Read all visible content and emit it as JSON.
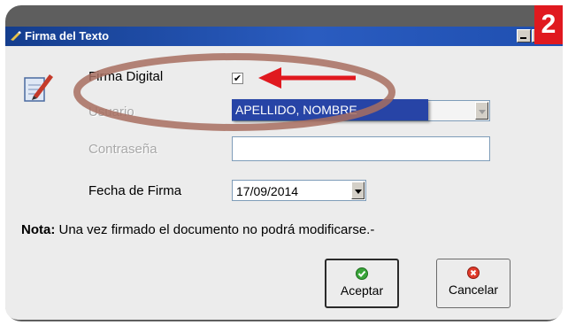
{
  "window": {
    "title": "Firma del Texto",
    "step_number": "2"
  },
  "form": {
    "firma_digital_label": "Firma Digital",
    "firma_digital_checked": true,
    "usuario_label": "Usuario",
    "usuario_value": "APELLIDO, NOMBRE",
    "contrasena_label": "Contraseña",
    "contrasena_value": "",
    "fecha_label": "Fecha de Firma",
    "fecha_value": "17/09/2014"
  },
  "note": {
    "label": "Nota:",
    "text": "Una vez firmado el documento no podrá modificarse.-"
  },
  "buttons": {
    "accept_label": "Aceptar",
    "cancel_label": "Cancelar"
  },
  "icons": {
    "app": "signature-pen-icon",
    "form": "document-pen-icon",
    "accept": "green-check-icon",
    "cancel": "red-x-icon"
  },
  "colors": {
    "titlebar": "#1f4fb0",
    "badge": "#e0191f",
    "annotation": "#b07a6c",
    "arrow": "#e0191f",
    "selection": "#2744a6"
  }
}
